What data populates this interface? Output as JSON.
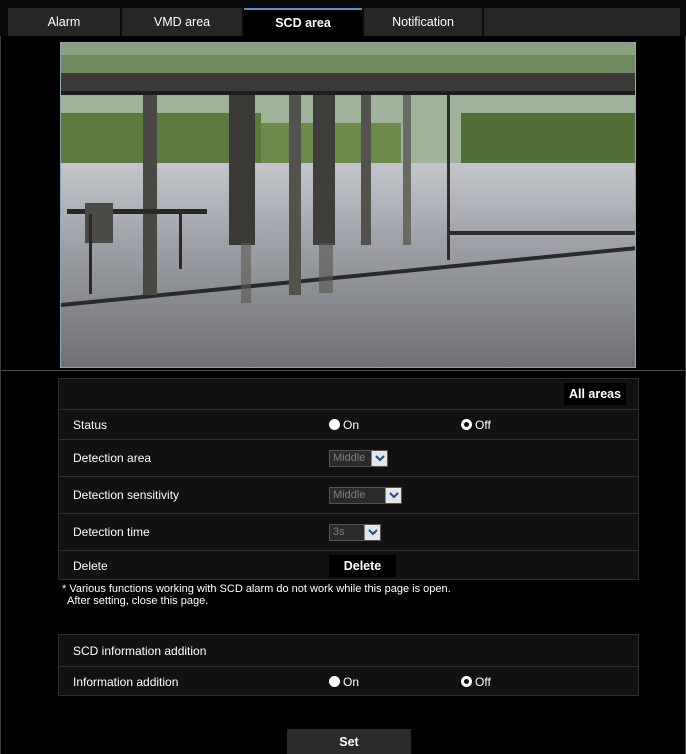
{
  "tabs": [
    {
      "label": "Alarm",
      "active": false
    },
    {
      "label": "VMD area",
      "active": false
    },
    {
      "label": "SCD area",
      "active": true
    },
    {
      "label": "Notification",
      "active": false
    }
  ],
  "camera": {
    "alt": "Camera live image"
  },
  "scd": {
    "all_areas_label": "All areas",
    "status": {
      "label": "Status",
      "on_label": "On",
      "off_label": "Off",
      "selected": "Off"
    },
    "detection_area": {
      "label": "Detection area",
      "value": "Middle"
    },
    "detection_sensitivity": {
      "label": "Detection sensitivity",
      "value": "Middle"
    },
    "detection_time": {
      "label": "Detection time",
      "value": "3s"
    },
    "delete": {
      "label": "Delete",
      "button_label": "Delete"
    }
  },
  "note": {
    "line1": "* Various functions working with SCD alarm do not work while this page is open.",
    "line2": "After setting, close this page."
  },
  "info_addition": {
    "section_title": "SCD information addition",
    "label": "Information addition",
    "on_label": "On",
    "off_label": "Off",
    "selected": "Off"
  },
  "set_label": "Set",
  "colors": {
    "accent": "#5f8dd3",
    "background": "#000000",
    "panel": "#111111"
  }
}
